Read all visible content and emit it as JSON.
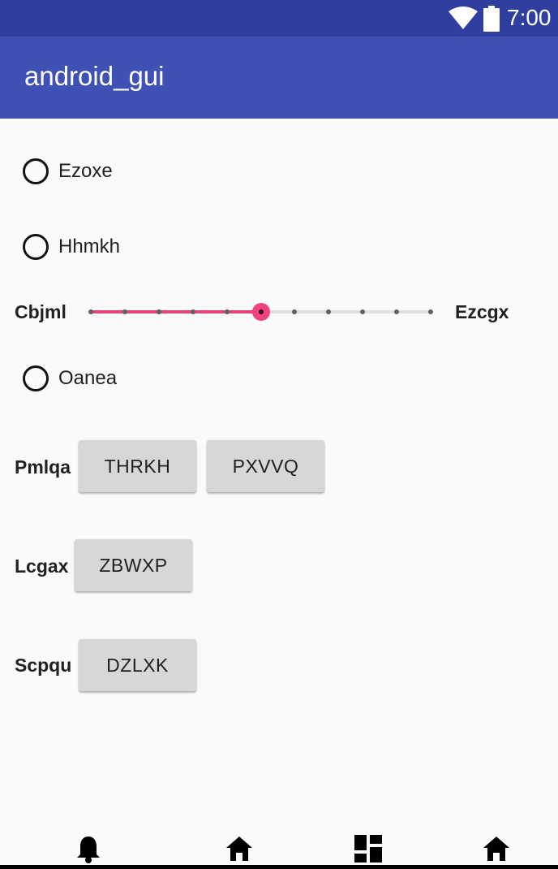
{
  "status_bar": {
    "time": "7:00",
    "icons": [
      "wifi-icon",
      "battery-icon"
    ]
  },
  "app_bar": {
    "title": "android_gui"
  },
  "radios": [
    {
      "label": "Ezoxe",
      "checked": false
    },
    {
      "label": "Hhmkh",
      "checked": false
    },
    {
      "label": "Oanea",
      "checked": false
    }
  ],
  "slider": {
    "left_label": "Cbjml",
    "right_label": "Ezcgx",
    "min": 0,
    "max": 10,
    "value": 5,
    "accent_color": "#e8437c"
  },
  "rows": [
    {
      "label": "Pmlqa",
      "buttons": [
        "THRKH",
        "PXVVQ"
      ]
    },
    {
      "label": "Lcgax",
      "buttons": [
        "ZBWXP"
      ]
    },
    {
      "label": "Scpqu",
      "buttons": [
        "DZLXK"
      ]
    }
  ],
  "bottom_nav": {
    "icons": [
      "bell-icon",
      "home-icon",
      "dashboard-icon",
      "home-icon"
    ]
  },
  "colors": {
    "status_bar": "#303f9f",
    "app_bar": "#3f51b5",
    "button_bg": "#d6d7d7",
    "background": "#fafafa"
  }
}
